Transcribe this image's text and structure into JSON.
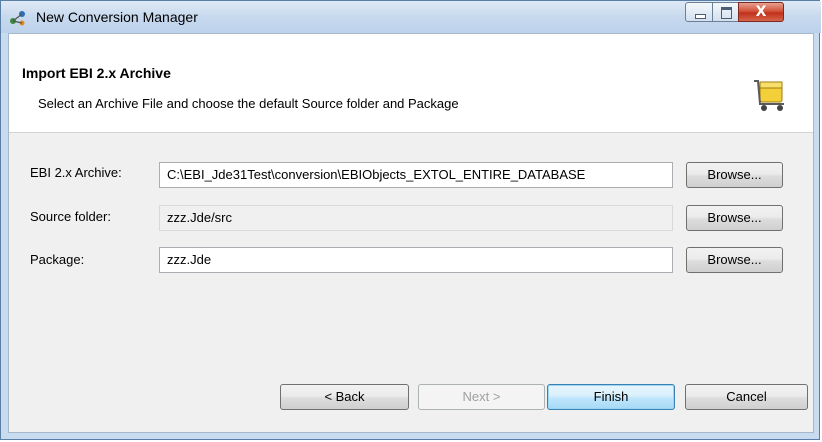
{
  "window": {
    "title": "New Conversion Manager",
    "icon": "conversion-manager-icon",
    "controls": {
      "minimize": "minimize",
      "maximize": "maximize",
      "close": "X"
    }
  },
  "header": {
    "title": "Import EBI 2.x Archive",
    "description": "Select an Archive File and choose the default Source folder and Package",
    "icon": "cart-with-box-icon"
  },
  "form": {
    "archive": {
      "label": "EBI 2.x Archive:",
      "value": "C:\\EBI_Jde31Test\\conversion\\EBIObjects_EXTOL_ENTIRE_DATABASE",
      "browse": "Browse..."
    },
    "source_folder": {
      "label": "Source folder:",
      "value": "zzz.Jde/src",
      "browse": "Browse..."
    },
    "package": {
      "label": "Package:",
      "value": "zzz.Jde",
      "browse": "Browse..."
    }
  },
  "footer": {
    "back": "< Back",
    "next": "Next >",
    "finish": "Finish",
    "cancel": "Cancel"
  },
  "colors": {
    "title_bar": "#c7d9ee",
    "close_button": "#c1301a",
    "default_button_border": "#3c7fb1"
  }
}
